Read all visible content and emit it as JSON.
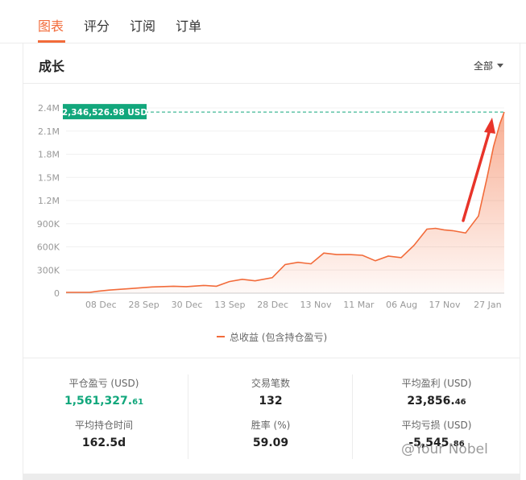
{
  "tabs": [
    "图表",
    "评分",
    "订阅",
    "订单"
  ],
  "section": {
    "title": "成长",
    "filter": "全部"
  },
  "stats": {
    "closed_pnl_label": "平仓盈亏 (USD)",
    "closed_pnl_main": "1,561,327.",
    "closed_pnl_frac": "61",
    "trades_label": "交易笔数",
    "trades_value": "132",
    "avg_profit_label": "平均盈利 (USD)",
    "avg_profit_main": "23,856.",
    "avg_profit_frac": "46",
    "avg_hold_label": "平均持仓时间",
    "avg_hold_value": "162.5d",
    "win_rate_label": "胜率 (%)",
    "win_rate_value": "59.09",
    "avg_loss_label": "平均亏损 (USD)",
    "avg_loss_main": "-5,545.",
    "avg_loss_frac": "86"
  },
  "watermark": "@Your Nobel",
  "colors": {
    "accent": "#f26b3a",
    "badge": "#12a77c",
    "annotation_arrow": "#e8342a"
  },
  "chart_data": {
    "type": "area",
    "legend": [
      "总收益 (包含持仓盈亏)"
    ],
    "legend_position": "bottom",
    "grid": true,
    "yticks": [
      "0",
      "300K",
      "600K",
      "900K",
      "1.2M",
      "1.5M",
      "1.8M",
      "2.1M",
      "2.4M"
    ],
    "ytick_values": [
      0,
      300000,
      600000,
      900000,
      1200000,
      1500000,
      1800000,
      2100000,
      2400000
    ],
    "ylim": [
      0,
      2400000
    ],
    "xticks": [
      "08 Dec",
      "28 Sep",
      "30 Dec",
      "13 Sep",
      "28 Dec",
      "13 Nov",
      "11 Mar",
      "06 Aug",
      "17 Nov",
      "27 Jan"
    ],
    "xtick_positions": [
      1,
      2,
      3,
      4,
      5,
      6,
      7,
      8,
      9,
      10
    ],
    "xlim": [
      0,
      10.2
    ],
    "max_label": "2,346,526.98 USD",
    "max_value": 2346526.98,
    "series": [
      {
        "name": "总收益 (包含持仓盈亏)",
        "x": [
          0,
          0.55,
          0.75,
          1.0,
          1.5,
          2.0,
          2.5,
          2.8,
          3.2,
          3.5,
          3.8,
          4.1,
          4.4,
          4.8,
          5.1,
          5.4,
          5.7,
          6.0,
          6.3,
          6.6,
          6.9,
          7.2,
          7.5,
          7.8,
          8.1,
          8.4,
          8.6,
          8.8,
          9.0,
          9.3,
          9.6,
          9.8,
          9.95,
          10.1,
          10.2
        ],
        "y": [
          10000,
          10000,
          25000,
          40000,
          60000,
          80000,
          90000,
          85000,
          100000,
          90000,
          150000,
          180000,
          160000,
          200000,
          370000,
          400000,
          380000,
          520000,
          500000,
          500000,
          490000,
          420000,
          480000,
          460000,
          620000,
          830000,
          840000,
          820000,
          810000,
          780000,
          1000000,
          1500000,
          1900000,
          2200000,
          2346527
        ]
      }
    ]
  }
}
